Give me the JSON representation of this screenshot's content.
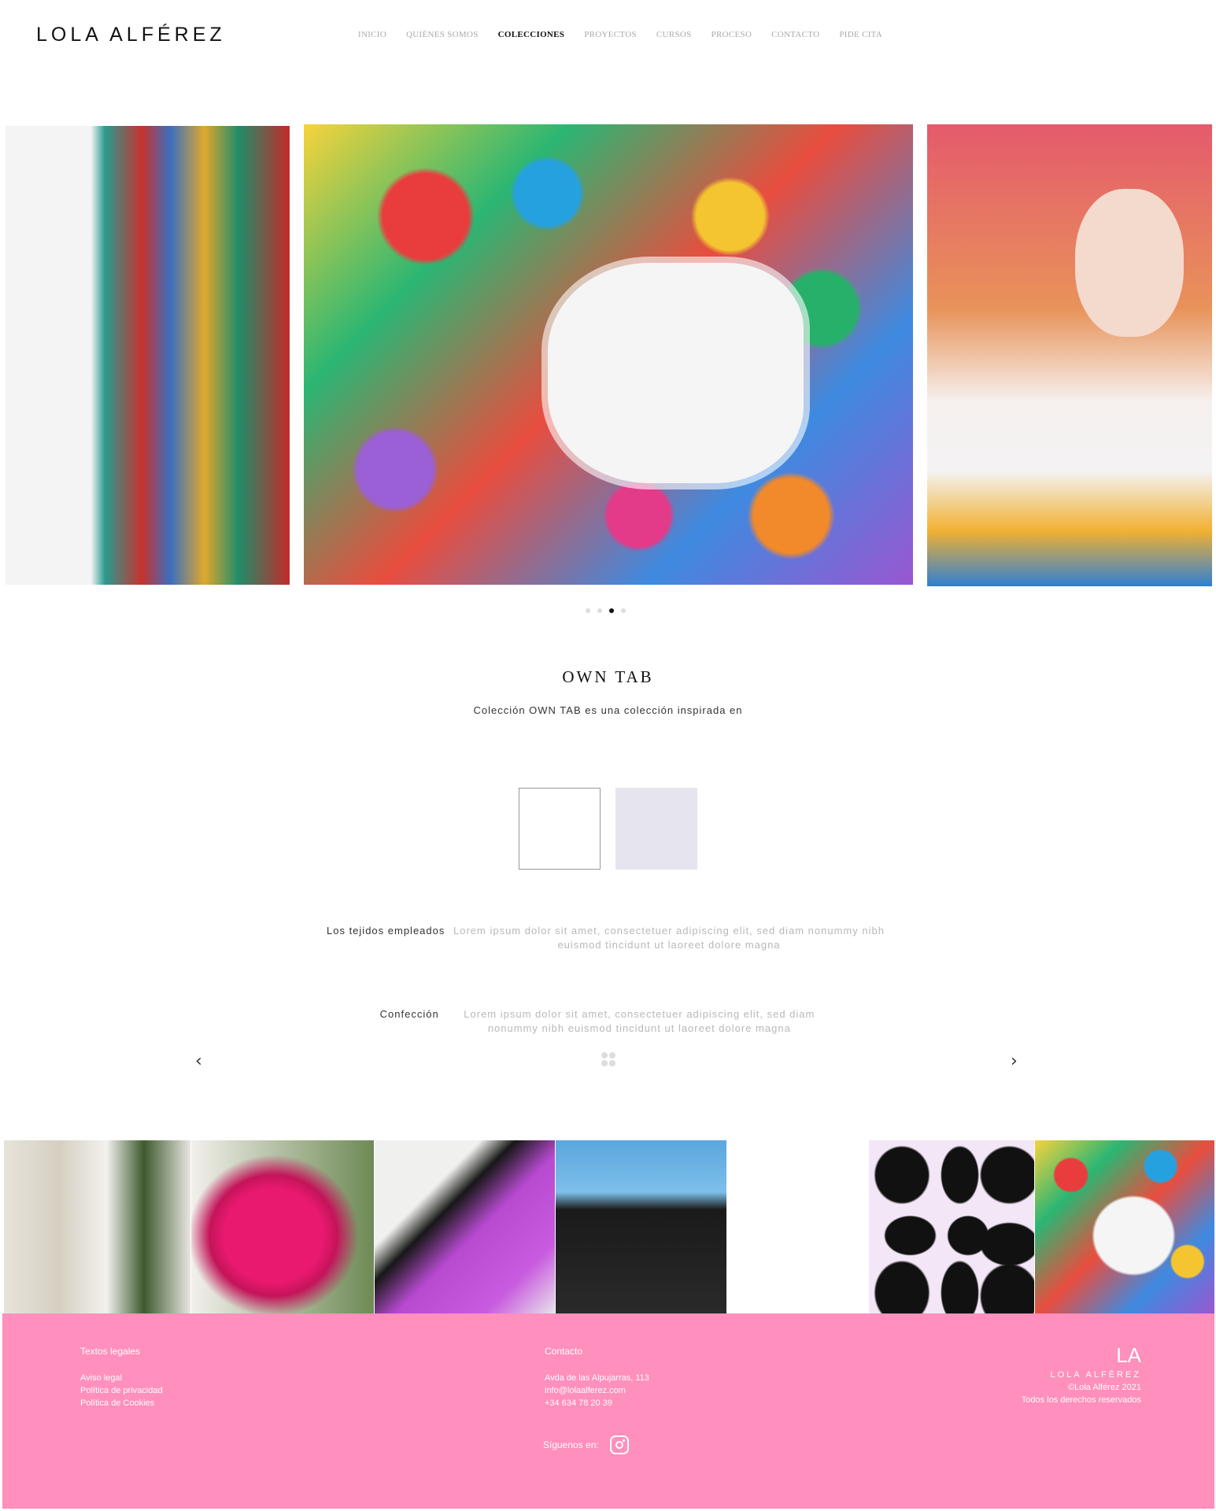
{
  "header": {
    "logo": "LOLA ALFÉREZ",
    "nav": [
      "INICIO",
      "QUIÉNES SOMOS",
      "COLECCIONES",
      "PROYECTOS",
      "CURSOS",
      "PROCESO",
      "CONTACTO",
      "PIDE CITA"
    ],
    "active_nav": "COLECCIONES"
  },
  "hero": {
    "dots_count": 4,
    "active_dot": 3
  },
  "collection": {
    "title": "OWN TAB",
    "subtitle": "Colección OWN TAB es una colección inspirada en",
    "swatches": [
      "#ffffff",
      "#e6e5ef"
    ],
    "fabrics_label": "Los tejidos empleados",
    "fabrics_text": "Lorem ipsum dolor sit amet, consectetuer adipiscing elit, sed diam nonummy nibh euismod tincidunt ut laoreet dolore magna",
    "making_label": "Confección",
    "making_text": "Lorem ipsum dolor sit amet, consectetuer adipiscing elit, sed diam nonummy nibh euismod tincidunt ut laoreet dolore magna"
  },
  "footer": {
    "legal_heading": "Textos legales",
    "legal_links": [
      "Aviso legal",
      "Política de privacidad",
      "Política de Cookies"
    ],
    "contact_heading": "Contacto",
    "address": "Avda de las Alpujarras, 113",
    "email": "info@lolaalferez.com",
    "phone": "+34 634 78 20 39",
    "follow_label": "Síguenos en:",
    "brand_logo": "LA",
    "brand_name": "LOLA ALFÉREZ",
    "copyright": "©Lola Alférez 2021",
    "rights": "Todos los derechos reservados"
  },
  "colors": {
    "footer_bg": "#ff8fbc",
    "text_dark": "#111111",
    "text_muted": "#b8b8b8"
  }
}
